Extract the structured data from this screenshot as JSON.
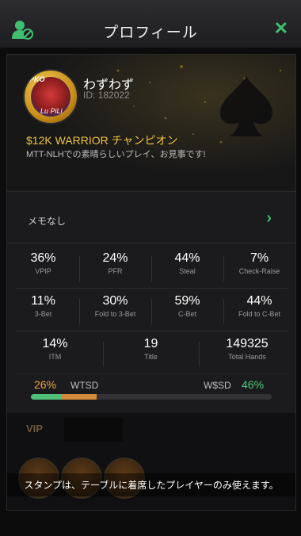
{
  "header": {
    "title": "プロフィール",
    "close_icon": "close-icon"
  },
  "profile": {
    "name": "わずわず",
    "id": "ID: 182022",
    "achievement_title": "$12K WARRIOR チャンピオン",
    "achievement_desc": "MTT-NLHでの素晴らしいプレイ、お見事です!",
    "avatar_text_top": "PKO",
    "avatar_text_bottom": "Lu PiLi"
  },
  "memo": {
    "label": "メモなし"
  },
  "stats": [
    [
      {
        "value": "36%",
        "label": "VPIP"
      },
      {
        "value": "24%",
        "label": "PFR"
      },
      {
        "value": "44%",
        "label": "Steal"
      },
      {
        "value": "7%",
        "label": "Check-Raise"
      }
    ],
    [
      {
        "value": "11%",
        "label": "3-Bet"
      },
      {
        "value": "30%",
        "label": "Fold to 3-Bet"
      },
      {
        "value": "59%",
        "label": "C-Bet"
      },
      {
        "value": "44%",
        "label": "Fold to C-Bet"
      }
    ],
    [
      {
        "value": "14%",
        "label": "ITM"
      },
      {
        "value": "19",
        "label": "Title"
      },
      {
        "value": "149325",
        "label": "Total Hands"
      }
    ]
  ],
  "showdown": {
    "wtsd_value": "26%",
    "wtsd_label": "WTSD",
    "wsd_label": "W$SD",
    "wsd_value": "46%",
    "wtsd_fraction": 0.26,
    "wsd_fraction_of_wtsd": 0.46
  },
  "bottom": {
    "vip_label": "VIP",
    "notice": "スタンプは、テーブルに着席したプレイヤーのみ使えます。"
  },
  "colors": {
    "accent_green": "#3fbf6f",
    "gold": "#f0c33c",
    "orange": "#d48a3d"
  }
}
